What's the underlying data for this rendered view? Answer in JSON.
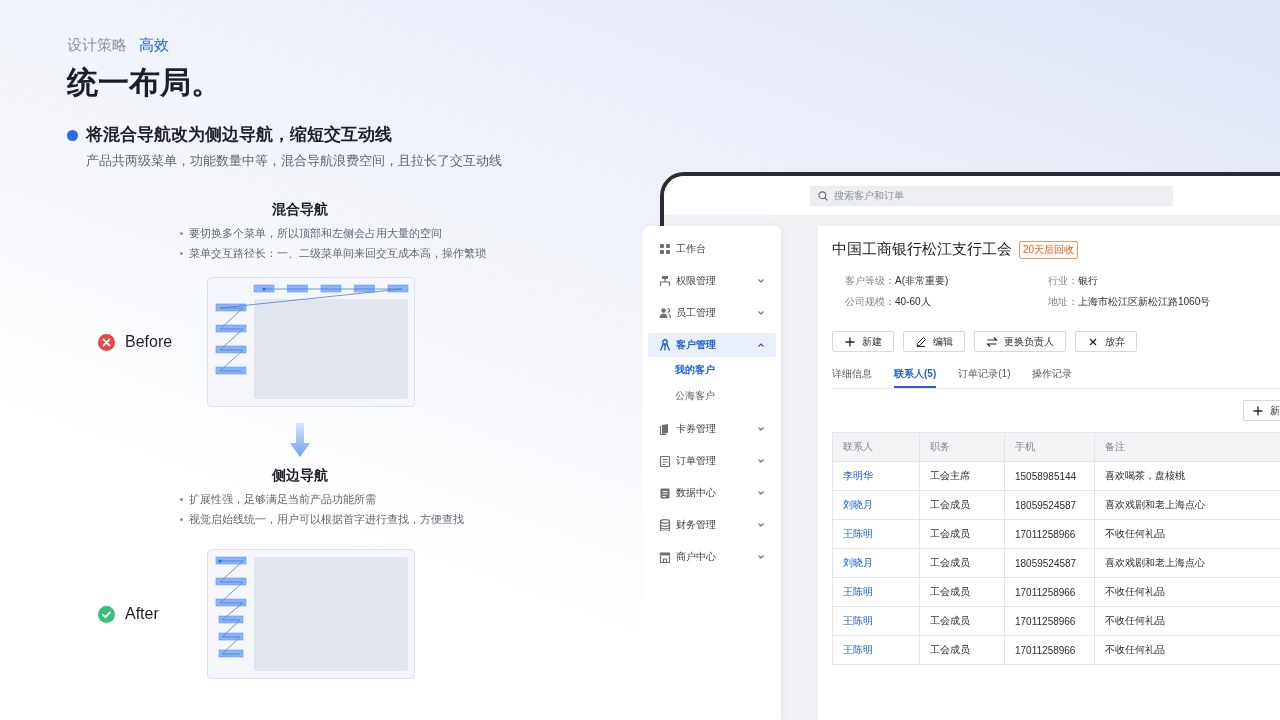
{
  "header": {
    "category": "设计策略",
    "tag": "高效"
  },
  "title": "统一布局。",
  "point": {
    "heading": "将混合导航改为侧边导航，缩短交互动线",
    "description": "产品共两级菜单，功能数量中等，混合导航浪费空间，且拉长了交互动线"
  },
  "comparisons": [
    {
      "kind": "mixed",
      "heading": "混合导航",
      "bullets": [
        "要切换多个菜单，所以顶部和左侧会占用大量的空间",
        "菜单交互路径长：一、二级菜单间来回交互成本高，操作繁琐"
      ],
      "label": "Before"
    },
    {
      "kind": "side",
      "heading": "侧边导航",
      "bullets": [
        "扩展性强，足够满足当前产品功能所需",
        "视觉启始线统一，用户可以根据首字进行查找，方便查找"
      ],
      "label": "After"
    }
  ],
  "app": {
    "search": {
      "placeholder": "搜索客户和订单"
    },
    "sidebar": {
      "items": [
        {
          "label": "工作台",
          "kind": "link",
          "selected": false
        },
        {
          "label": "权限管理",
          "kind": "group",
          "selected": false,
          "expanded": false
        },
        {
          "label": "员工管理",
          "kind": "group",
          "selected": false,
          "expanded": false
        },
        {
          "label": "客户管理",
          "kind": "group",
          "selected": true,
          "expanded": true,
          "children": [
            {
              "label": "我的客户",
              "selected": true
            },
            {
              "label": "公海客户",
              "selected": false
            }
          ]
        },
        {
          "label": "卡券管理",
          "kind": "group",
          "selected": false,
          "expanded": false
        },
        {
          "label": "订单管理",
          "kind": "group",
          "selected": false,
          "expanded": false
        },
        {
          "label": "数据中心",
          "kind": "group",
          "selected": false,
          "expanded": false
        },
        {
          "label": "财务管理",
          "kind": "group",
          "selected": false,
          "expanded": false
        },
        {
          "label": "商户中心",
          "kind": "group",
          "selected": false,
          "expanded": false
        }
      ]
    },
    "customer": {
      "name": "中国工商银行松江支行工会",
      "badge": "20天后回收",
      "fields": [
        {
          "label": "客户等级：",
          "value": "A(非常重要)"
        },
        {
          "label": "行业：",
          "value": "银行"
        },
        {
          "label": "公司规模：",
          "value": "40-60人"
        },
        {
          "label": "地址：",
          "value": "上海市松江区新松江路1060号"
        }
      ],
      "actions": [
        "新建",
        "编辑",
        "更换负责人",
        "放弃"
      ]
    },
    "tabs": [
      {
        "label": "详细信息",
        "selected": false
      },
      {
        "label": "联系人(5)",
        "selected": true
      },
      {
        "label": "订单记录(1)",
        "selected": false
      },
      {
        "label": "操作记录",
        "selected": false
      }
    ],
    "add_button": "新",
    "table": {
      "columns": [
        "联系人",
        "职务",
        "手机",
        "备注"
      ],
      "rows": [
        [
          "李明华",
          "工会主席",
          "15058985144",
          "喜欢喝茶，盘核桃"
        ],
        [
          "刘晓月",
          "工会成员",
          "18059524587",
          "喜欢戏剧和老上海点心"
        ],
        [
          "王陈明",
          "工会成员",
          "17011258966",
          "不收任何礼品"
        ],
        [
          "刘晓月",
          "工会成员",
          "18059524587",
          "喜欢戏剧和老上海点心"
        ],
        [
          "王陈明",
          "工会成员",
          "17011258966",
          "不收任何礼品"
        ],
        [
          "王陈明",
          "工会成员",
          "17011258966",
          "不收任何礼品"
        ],
        [
          "王陈明",
          "工会成员",
          "17011258966",
          "不收任何礼品"
        ]
      ]
    }
  }
}
